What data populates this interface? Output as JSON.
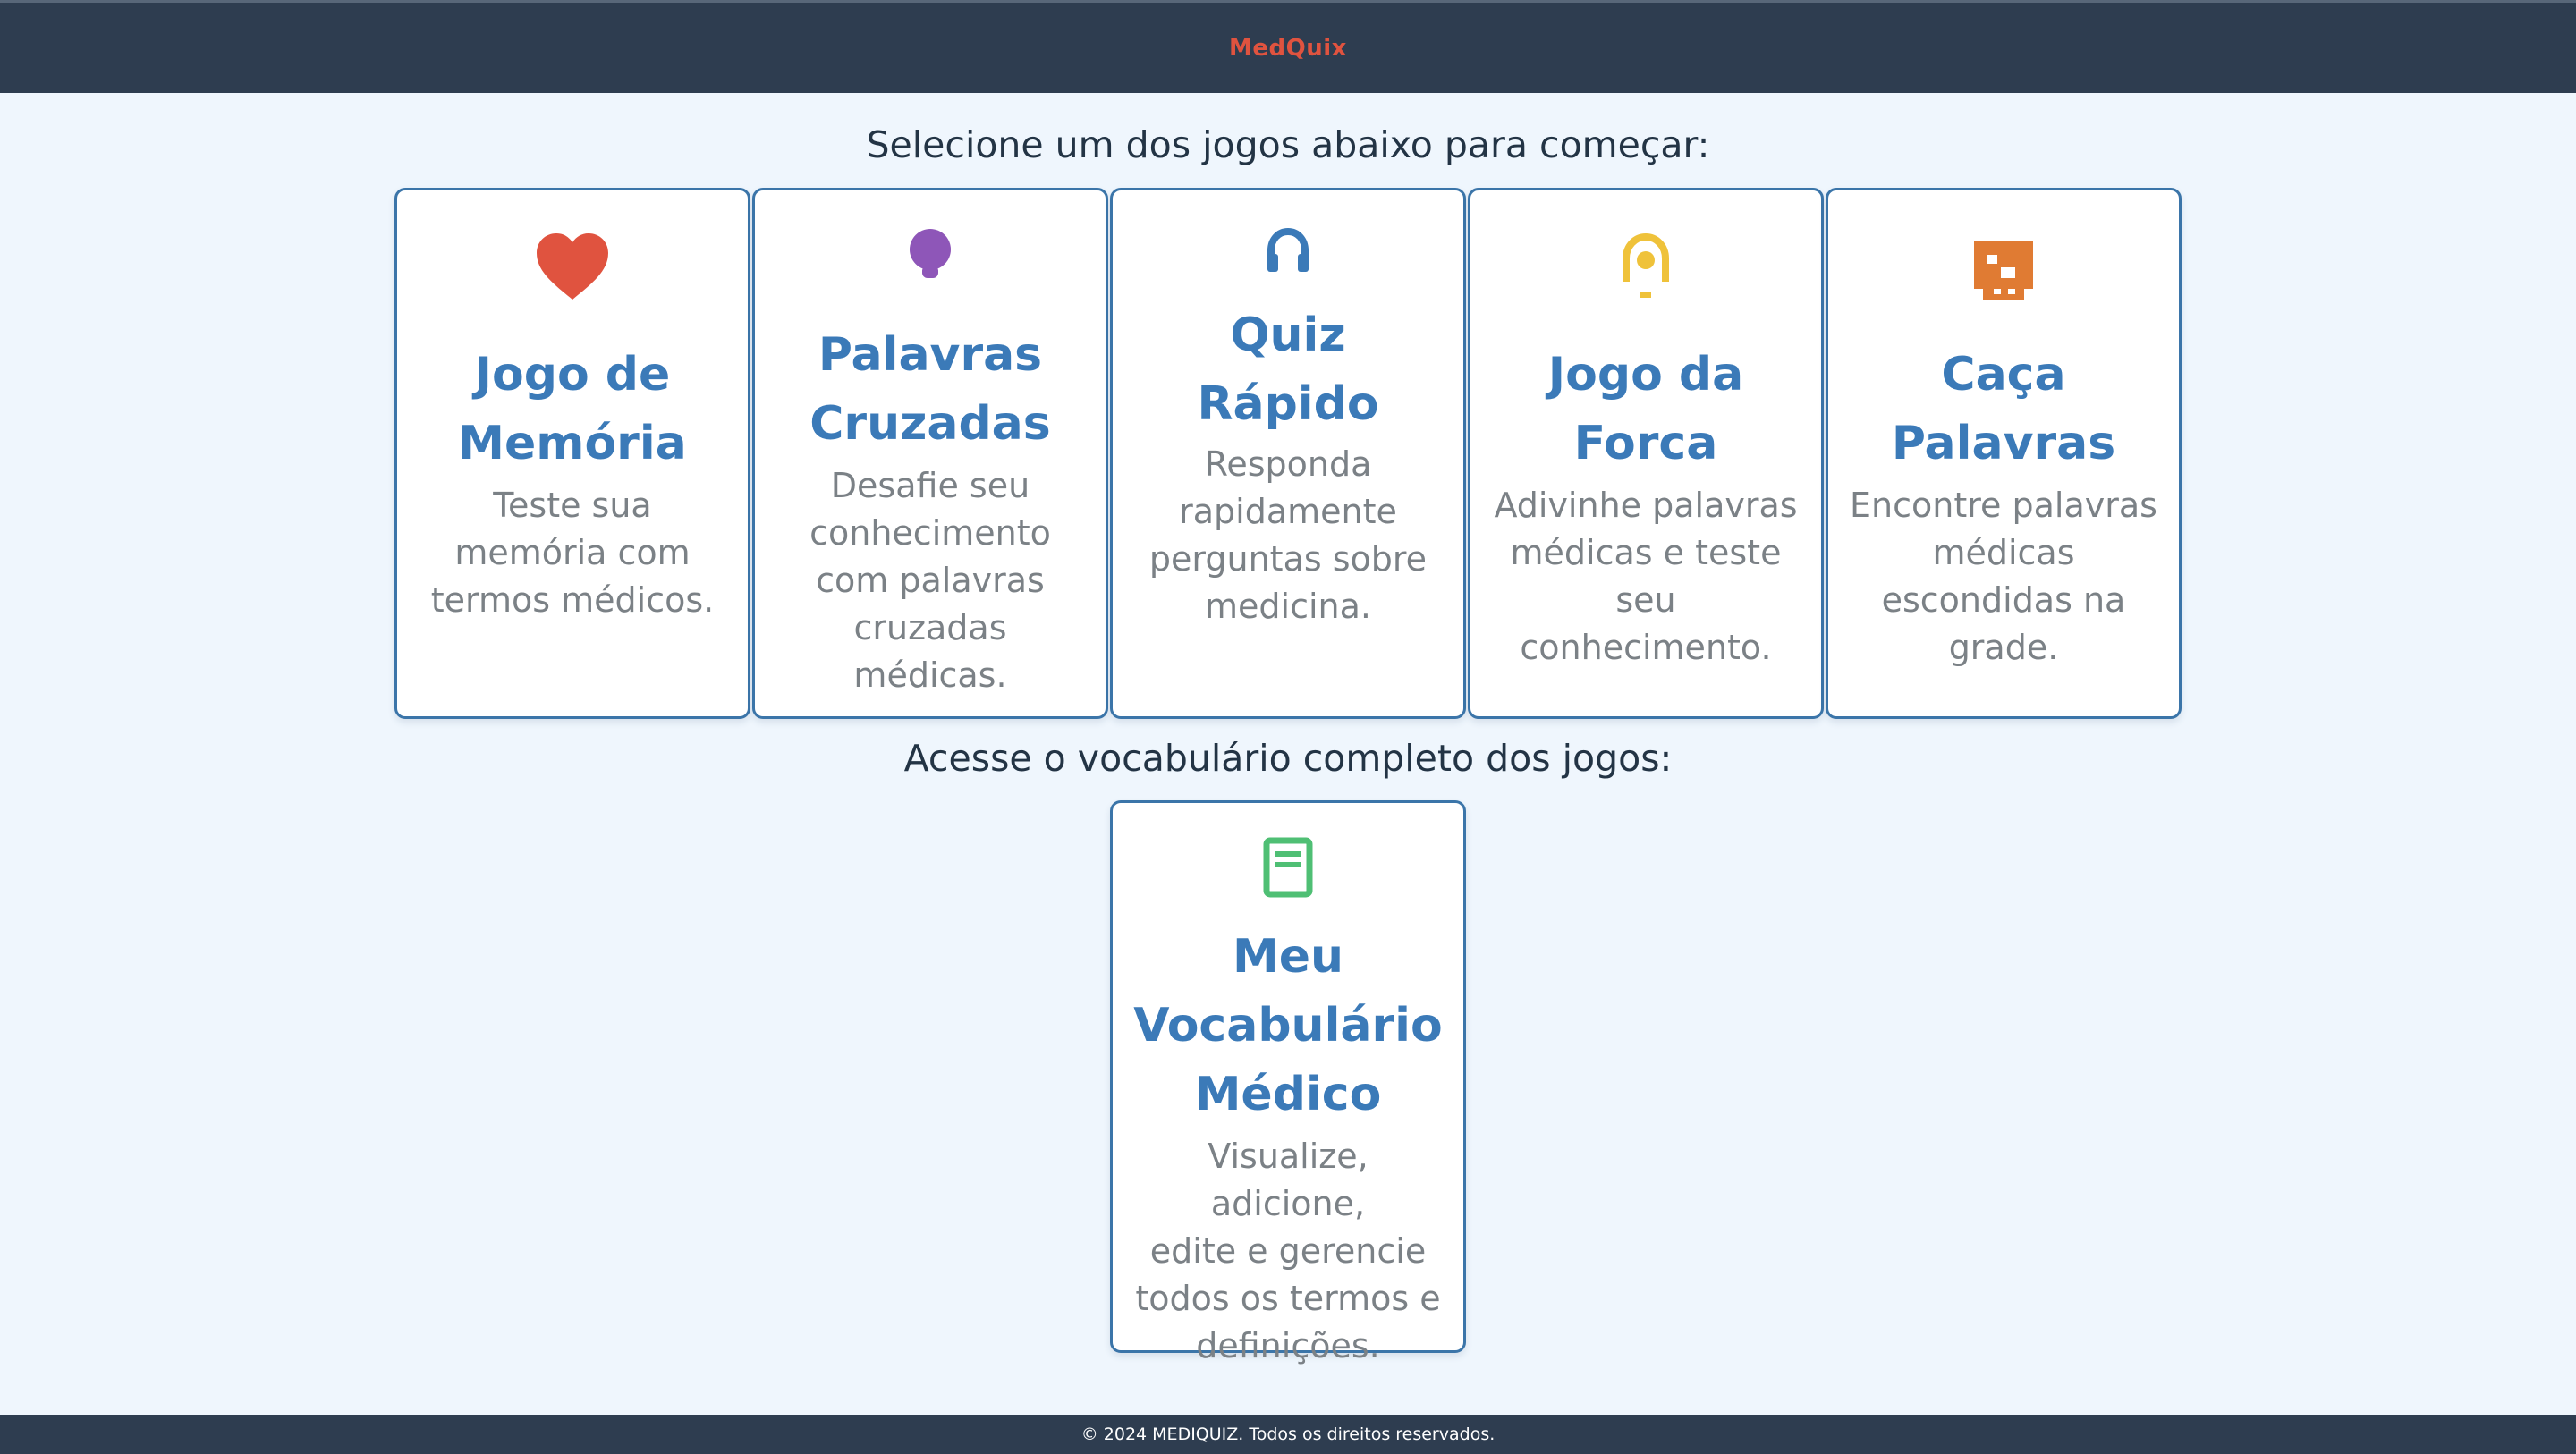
{
  "header": {
    "brand": "MedQuix"
  },
  "sections": {
    "games_title": "Selecione um dos jogos abaixo para começar:",
    "vocab_title": "Acesse o vocabulário completo dos jogos:"
  },
  "games": [
    {
      "icon": "heart-icon",
      "color": "#e0533f",
      "title_line1": "Jogo de",
      "title_line2": "Memória",
      "desc": [
        "Teste sua",
        "memória com",
        "termos médicos."
      ]
    },
    {
      "icon": "lightbulb-icon",
      "color": "#8e56b8",
      "title_line1": "Palavras",
      "title_line2": "Cruzadas",
      "desc": [
        "Desafie seu",
        "conhecimento",
        "com palavras",
        "cruzadas",
        "médicas."
      ]
    },
    {
      "icon": "headphones-icon",
      "color": "#3b7ab8",
      "title_line1": "Quiz Rápido",
      "title_line2": "",
      "desc": [
        "Responda",
        "rapidamente",
        "perguntas sobre",
        "medicina."
      ]
    },
    {
      "icon": "hangman-icon",
      "color": "#efc23a",
      "title_line1": "Jogo da",
      "title_line2": "Forca",
      "desc": [
        "Adivinhe palavras",
        "médicas e teste",
        "seu",
        "conhecimento."
      ]
    },
    {
      "icon": "grid-icon",
      "color": "#e07b33",
      "title_line1": "Caça",
      "title_line2": "Palavras",
      "desc": [
        "Encontre palavras",
        "médicas",
        "escondidas na",
        "grade."
      ]
    }
  ],
  "vocab": {
    "icon": "book-icon",
    "color": "#4fbf74",
    "title_lines": [
      "Meu",
      "Vocabulário",
      "Médico"
    ],
    "desc": [
      "Visualize, adicione,",
      "edite e gerencie",
      "todos os termos e",
      "definições."
    ]
  },
  "footer": {
    "text": "© 2024 MEDIQUIZ. Todos os direitos reservados."
  }
}
